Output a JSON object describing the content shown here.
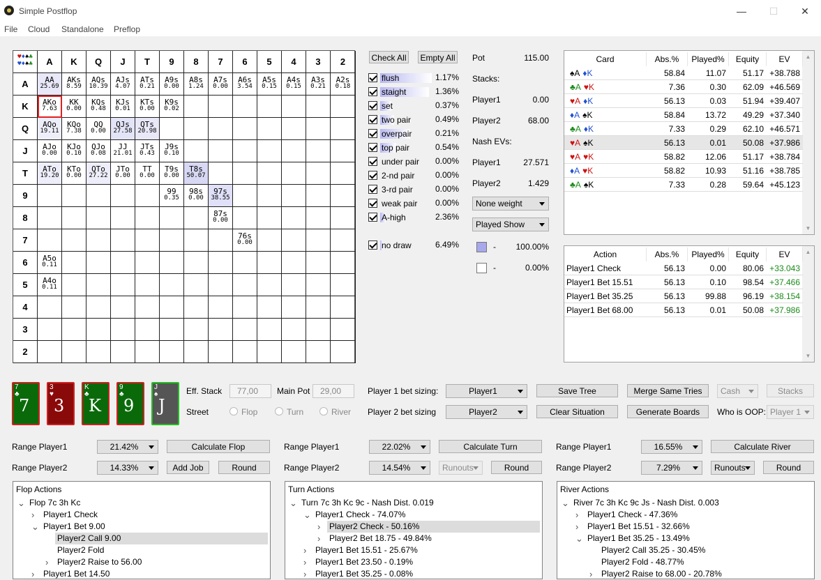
{
  "app": {
    "title": "Simple Postflop"
  },
  "menu": [
    "File",
    "Cloud",
    "Standalone",
    "Preflop"
  ],
  "grid": {
    "header": [
      "A",
      "K",
      "Q",
      "J",
      "T",
      "9",
      "8",
      "7",
      "6",
      "5",
      "4",
      "3",
      "2"
    ],
    "cells": [
      {
        "r": 0,
        "c": 0,
        "h": "AA",
        "v": "25.69",
        "hl": "#e8e8f8"
      },
      {
        "r": 0,
        "c": 1,
        "h": "AKs",
        "v": "8.59"
      },
      {
        "r": 0,
        "c": 2,
        "h": "AQs",
        "v": "10.39"
      },
      {
        "r": 0,
        "c": 3,
        "h": "AJs",
        "v": "4.07"
      },
      {
        "r": 0,
        "c": 4,
        "h": "ATs",
        "v": "0.21"
      },
      {
        "r": 0,
        "c": 5,
        "h": "A9s",
        "v": "0.00"
      },
      {
        "r": 0,
        "c": 6,
        "h": "A8s",
        "v": "1.24"
      },
      {
        "r": 0,
        "c": 7,
        "h": "A7s",
        "v": "0.00"
      },
      {
        "r": 0,
        "c": 8,
        "h": "A6s",
        "v": "3.54"
      },
      {
        "r": 0,
        "c": 9,
        "h": "A5s",
        "v": "0.15"
      },
      {
        "r": 0,
        "c": 10,
        "h": "A4s",
        "v": "0.15"
      },
      {
        "r": 0,
        "c": 11,
        "h": "A3s",
        "v": "0.21"
      },
      {
        "r": 0,
        "c": 12,
        "h": "A2s",
        "v": "0.18"
      },
      {
        "r": 1,
        "c": 0,
        "h": "AKo",
        "v": "7.63",
        "sel": true
      },
      {
        "r": 1,
        "c": 1,
        "h": "KK",
        "v": "0.00"
      },
      {
        "r": 1,
        "c": 2,
        "h": "KQs",
        "v": "0.48"
      },
      {
        "r": 1,
        "c": 3,
        "h": "KJs",
        "v": "0.01"
      },
      {
        "r": 1,
        "c": 4,
        "h": "KTs",
        "v": "0.00"
      },
      {
        "r": 1,
        "c": 5,
        "h": "K9s",
        "v": "0.02"
      },
      {
        "r": 2,
        "c": 0,
        "h": "AQo",
        "v": "19.11",
        "hl": "#eeeefa"
      },
      {
        "r": 2,
        "c": 1,
        "h": "KQo",
        "v": "7.38"
      },
      {
        "r": 2,
        "c": 2,
        "h": "QQ",
        "v": "0.00"
      },
      {
        "r": 2,
        "c": 3,
        "h": "QJs",
        "v": "27.58",
        "hl": "#e4e4f8"
      },
      {
        "r": 2,
        "c": 4,
        "h": "QTs",
        "v": "20.98",
        "hl": "#e8e8f8"
      },
      {
        "r": 3,
        "c": 0,
        "h": "AJo",
        "v": "0.00"
      },
      {
        "r": 3,
        "c": 1,
        "h": "KJo",
        "v": "0.10"
      },
      {
        "r": 3,
        "c": 2,
        "h": "QJo",
        "v": "0.08"
      },
      {
        "r": 3,
        "c": 3,
        "h": "JJ",
        "v": "21.01"
      },
      {
        "r": 3,
        "c": 4,
        "h": "JTs",
        "v": "0.43"
      },
      {
        "r": 3,
        "c": 5,
        "h": "J9s",
        "v": "0.10"
      },
      {
        "r": 4,
        "c": 0,
        "h": "ATo",
        "v": "19.20",
        "hl": "#eeeefa"
      },
      {
        "r": 4,
        "c": 1,
        "h": "KTo",
        "v": "0.00"
      },
      {
        "r": 4,
        "c": 2,
        "h": "QTo",
        "v": "27.22",
        "hl": "#eeeefa"
      },
      {
        "r": 4,
        "c": 3,
        "h": "JTo",
        "v": "0.00"
      },
      {
        "r": 4,
        "c": 4,
        "h": "TT",
        "v": "0.00"
      },
      {
        "r": 4,
        "c": 5,
        "h": "T9s",
        "v": "0.00"
      },
      {
        "r": 4,
        "c": 6,
        "h": "T8s",
        "v": "50.07",
        "hl": "#d8d8f4"
      },
      {
        "r": 5,
        "c": 5,
        "h": "99",
        "v": "0.35"
      },
      {
        "r": 5,
        "c": 6,
        "h": "98s",
        "v": "0.00"
      },
      {
        "r": 5,
        "c": 7,
        "h": "97s",
        "v": "38.55",
        "hl": "#e0e0f8"
      },
      {
        "r": 6,
        "c": 7,
        "h": "87s",
        "v": "0.00"
      },
      {
        "r": 7,
        "c": 8,
        "h": "76s",
        "v": "0.00"
      },
      {
        "r": 8,
        "c": 0,
        "h": "A5o",
        "v": "0.11"
      },
      {
        "r": 9,
        "c": 0,
        "h": "A4o",
        "v": "0.11"
      }
    ]
  },
  "filters": {
    "check_all": "Check All",
    "empty_all": "Empty All",
    "items": [
      {
        "label": "flush",
        "pct": "1.17%",
        "fill": 0.95
      },
      {
        "label": "staight",
        "pct": "1.36%",
        "fill": 0.9
      },
      {
        "label": "set",
        "pct": "0.37%",
        "fill": 0.2
      },
      {
        "label": "two pair",
        "pct": "0.49%",
        "fill": 0.25
      },
      {
        "label": "overpair",
        "pct": "0.21%",
        "fill": 0.55
      },
      {
        "label": "top pair",
        "pct": "0.54%",
        "fill": 0.3
      },
      {
        "label": "under pair",
        "pct": "0.00%",
        "fill": 0.0
      },
      {
        "label": "2-nd pair",
        "pct": "0.00%",
        "fill": 0.0
      },
      {
        "label": "3-rd pair",
        "pct": "0.00%",
        "fill": 0.0
      },
      {
        "label": "weak pair",
        "pct": "0.00%",
        "fill": 0.0
      },
      {
        "label": "A-high",
        "pct": "2.36%",
        "fill": 0.1
      }
    ],
    "no_draw": {
      "label": "no draw",
      "pct": "6.49%",
      "fill": 0.05
    }
  },
  "info": {
    "pot_label": "Pot",
    "pot": "115.00",
    "stacks_label": "Stacks:",
    "p1": "Player1",
    "p1_stack": "0.00",
    "p2": "Player2",
    "p2_stack": "68.00",
    "nash_label": "Nash EVs:",
    "p1_ev": "27.571",
    "p2_ev": "1.429",
    "weight_combo": "None weight",
    "show_combo": "Played Show",
    "legend1": "100.00%",
    "legend2": "0.00%",
    "dash": "-"
  },
  "card_table": {
    "headers": [
      "Card",
      "Abs.%",
      "Played%",
      "Equity",
      "EV"
    ],
    "rows": [
      {
        "c1": "♠A",
        "c1c": "#000",
        "c2": "♦K",
        "c2c": "#2050d0",
        "abs": "58.84",
        "pl": "11.07",
        "eq": "51.17",
        "ev": "+38.788"
      },
      {
        "c1": "♣A",
        "c1c": "#1a8a1a",
        "c2": "♥K",
        "c2c": "#d01010",
        "abs": "7.36",
        "pl": "0.30",
        "eq": "62.09",
        "ev": "+46.569"
      },
      {
        "c1": "♥A",
        "c1c": "#d01010",
        "c2": "♦K",
        "c2c": "#2050d0",
        "abs": "56.13",
        "pl": "0.03",
        "eq": "51.94",
        "ev": "+39.407"
      },
      {
        "c1": "♦A",
        "c1c": "#2050d0",
        "c2": "♠K",
        "c2c": "#000",
        "abs": "58.84",
        "pl": "13.72",
        "eq": "49.29",
        "ev": "+37.340"
      },
      {
        "c1": "♣A",
        "c1c": "#1a8a1a",
        "c2": "♦K",
        "c2c": "#2050d0",
        "abs": "7.33",
        "pl": "0.29",
        "eq": "62.10",
        "ev": "+46.571"
      },
      {
        "c1": "♥A",
        "c1c": "#d01010",
        "c2": "♠K",
        "c2c": "#000",
        "abs": "56.13",
        "pl": "0.01",
        "eq": "50.08",
        "ev": "+37.986",
        "sel": true
      },
      {
        "c1": "♥A",
        "c1c": "#d01010",
        "c2": "♥K",
        "c2c": "#d01010",
        "abs": "58.82",
        "pl": "12.06",
        "eq": "51.17",
        "ev": "+38.784"
      },
      {
        "c1": "♦A",
        "c1c": "#2050d0",
        "c2": "♥K",
        "c2c": "#d01010",
        "abs": "58.82",
        "pl": "10.93",
        "eq": "51.16",
        "ev": "+38.785"
      },
      {
        "c1": "♣A",
        "c1c": "#1a8a1a",
        "c2": "♠K",
        "c2c": "#000",
        "abs": "7.33",
        "pl": "0.28",
        "eq": "59.64",
        "ev": "+45.123"
      }
    ]
  },
  "action_table": {
    "headers": [
      "Action",
      "Abs.%",
      "Played%",
      "Equity",
      "EV"
    ],
    "rows": [
      {
        "a": "Player1 Check",
        "abs": "56.13",
        "pl": "0.00",
        "eq": "80.06",
        "ev": "+33.043"
      },
      {
        "a": "Player1 Bet 15.51",
        "abs": "56.13",
        "pl": "0.10",
        "eq": "98.54",
        "ev": "+37.466"
      },
      {
        "a": "Player1 Bet 35.25",
        "abs": "56.13",
        "pl": "99.88",
        "eq": "96.19",
        "ev": "+38.154"
      },
      {
        "a": "Player1 Bet 68.00",
        "abs": "56.13",
        "pl": "0.01",
        "eq": "50.08",
        "ev": "+37.986"
      }
    ]
  },
  "board": [
    {
      "rank": "7",
      "suit": "♣",
      "bg": "#0a6a0a",
      "border": "#d02020"
    },
    {
      "rank": "3",
      "suit": "♥",
      "bg": "#8a0a0a",
      "border": "#d02020"
    },
    {
      "rank": "K",
      "suit": "♣",
      "bg": "#0a6a0a",
      "border": "#d02020"
    },
    {
      "rank": "9",
      "suit": "♣",
      "bg": "#0a6a0a",
      "border": "#d02020"
    },
    {
      "rank": "J",
      "suit": "♠",
      "bg": "#555",
      "border": "#20c020"
    }
  ],
  "controls": {
    "eff_stack_label": "Eff. Stack",
    "eff_stack": "77,00",
    "main_pot_label": "Main Pot",
    "main_pot": "29,00",
    "street_label": "Street",
    "flop": "Flop",
    "turn": "Turn",
    "river": "River",
    "p1_sizing_label": "Player 1 bet sizing:",
    "p2_sizing_label": "Player 2 bet sizing",
    "p1_combo": "Player1",
    "p2_combo": "Player2",
    "save_tree": "Save Tree",
    "clear_situation": "Clear Situation",
    "merge": "Merge Same Tries",
    "generate": "Generate Boards",
    "cash": "Cash",
    "stacks": "Stacks",
    "who_oop": "Who is OOP:",
    "oop_val": "Player 1"
  },
  "ranges": {
    "rp1": "Range Player1",
    "rp2": "Range Player2",
    "flop_p1": "21.42%",
    "flop_p2": "14.33%",
    "turn_p1": "22.02%",
    "turn_p2": "14.54%",
    "river_p1": "16.55%",
    "river_p2": "7.29%",
    "calc_flop": "Calculate Flop",
    "calc_turn": "Calculate Turn",
    "calc_river": "Calculate River",
    "add_job": "Add Job",
    "round": "Round",
    "runouts": "Runouts"
  },
  "trees": {
    "flop": {
      "title": "Flop Actions",
      "items": [
        {
          "t": "Flop 7c 3h Kc",
          "lvl": 0,
          "arr": "v"
        },
        {
          "t": "Player1 Check",
          "lvl": 1,
          "arr": ">"
        },
        {
          "t": "Player1 Bet 9.00",
          "lvl": 1,
          "arr": "v"
        },
        {
          "t": "Player2 Call 9.00",
          "lvl": 2,
          "arr": "",
          "sel": true
        },
        {
          "t": "Player2 Fold",
          "lvl": 2,
          "arr": ""
        },
        {
          "t": "Player2 Raise to 56.00",
          "lvl": 2,
          "arr": ">"
        },
        {
          "t": "Player1 Bet 14.50",
          "lvl": 1,
          "arr": ">"
        }
      ]
    },
    "turn": {
      "title": "Turn Actions",
      "items": [
        {
          "t": "Turn 7c 3h Kc 9c - Nash Dist. 0.019",
          "lvl": 0,
          "arr": "v"
        },
        {
          "t": "Player1 Check - 74.07%",
          "lvl": 1,
          "arr": "v"
        },
        {
          "t": "Player2 Check - 50.16%",
          "lvl": 2,
          "arr": ">",
          "sel": true
        },
        {
          "t": "Player2 Bet 18.75 - 49.84%",
          "lvl": 2,
          "arr": ">"
        },
        {
          "t": "Player1 Bet 15.51 - 25.67%",
          "lvl": 1,
          "arr": ">"
        },
        {
          "t": "Player1 Bet 23.50 - 0.19%",
          "lvl": 1,
          "arr": ">"
        },
        {
          "t": "Player1 Bet 35.25 - 0.08%",
          "lvl": 1,
          "arr": ">"
        }
      ]
    },
    "river": {
      "title": "River Actions",
      "items": [
        {
          "t": "River 7c 3h Kc 9c Js - Nash Dist. 0.003",
          "lvl": 0,
          "arr": "v"
        },
        {
          "t": "Player1 Check - 47.36%",
          "lvl": 1,
          "arr": ">"
        },
        {
          "t": "Player1 Bet 15.51 - 32.66%",
          "lvl": 1,
          "arr": ">"
        },
        {
          "t": "Player1 Bet 35.25 - 13.49%",
          "lvl": 1,
          "arr": "v"
        },
        {
          "t": "Player2 Call 35.25 - 30.45%",
          "lvl": 2,
          "arr": ""
        },
        {
          "t": "Player2 Fold - 48.77%",
          "lvl": 2,
          "arr": ""
        },
        {
          "t": "Player2 Raise to 68.00 - 20.78%",
          "lvl": 2,
          "arr": ">"
        }
      ]
    }
  }
}
